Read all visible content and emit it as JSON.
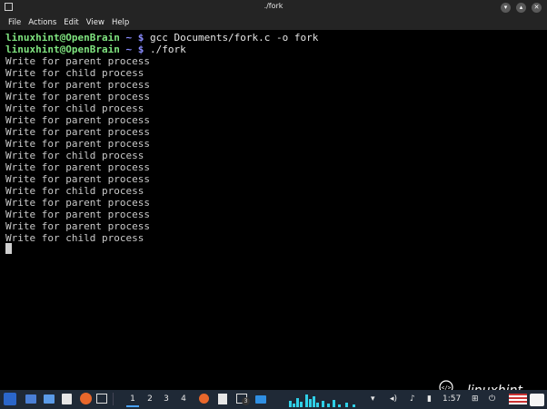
{
  "window": {
    "title": "./fork"
  },
  "menu": [
    "File",
    "Actions",
    "Edit",
    "View",
    "Help"
  ],
  "terminal": {
    "prompt": "linuxhint@OpenBrain",
    "tilde_sign": "~ $",
    "commands": [
      "gcc Documents/fork.c -o fork",
      "./fork"
    ],
    "output": [
      "Write for parent process",
      "Write for child process",
      "Write for parent process",
      "Write for parent process",
      "Write for child process",
      "Write for parent process",
      "Write for parent process",
      "Write for parent process",
      "Write for child process",
      "Write for parent process",
      "Write for parent process",
      "Write for child process",
      "Write for parent process",
      "Write for parent process",
      "Write for parent process",
      "Write for child process"
    ]
  },
  "watermark": {
    "text": "linuxhint",
    "symbol": "</>"
  },
  "taskbar": {
    "workspaces": [
      "1",
      "2",
      "3",
      "4"
    ],
    "active_workspace": "1",
    "badge": "3",
    "clock": "1:57"
  }
}
